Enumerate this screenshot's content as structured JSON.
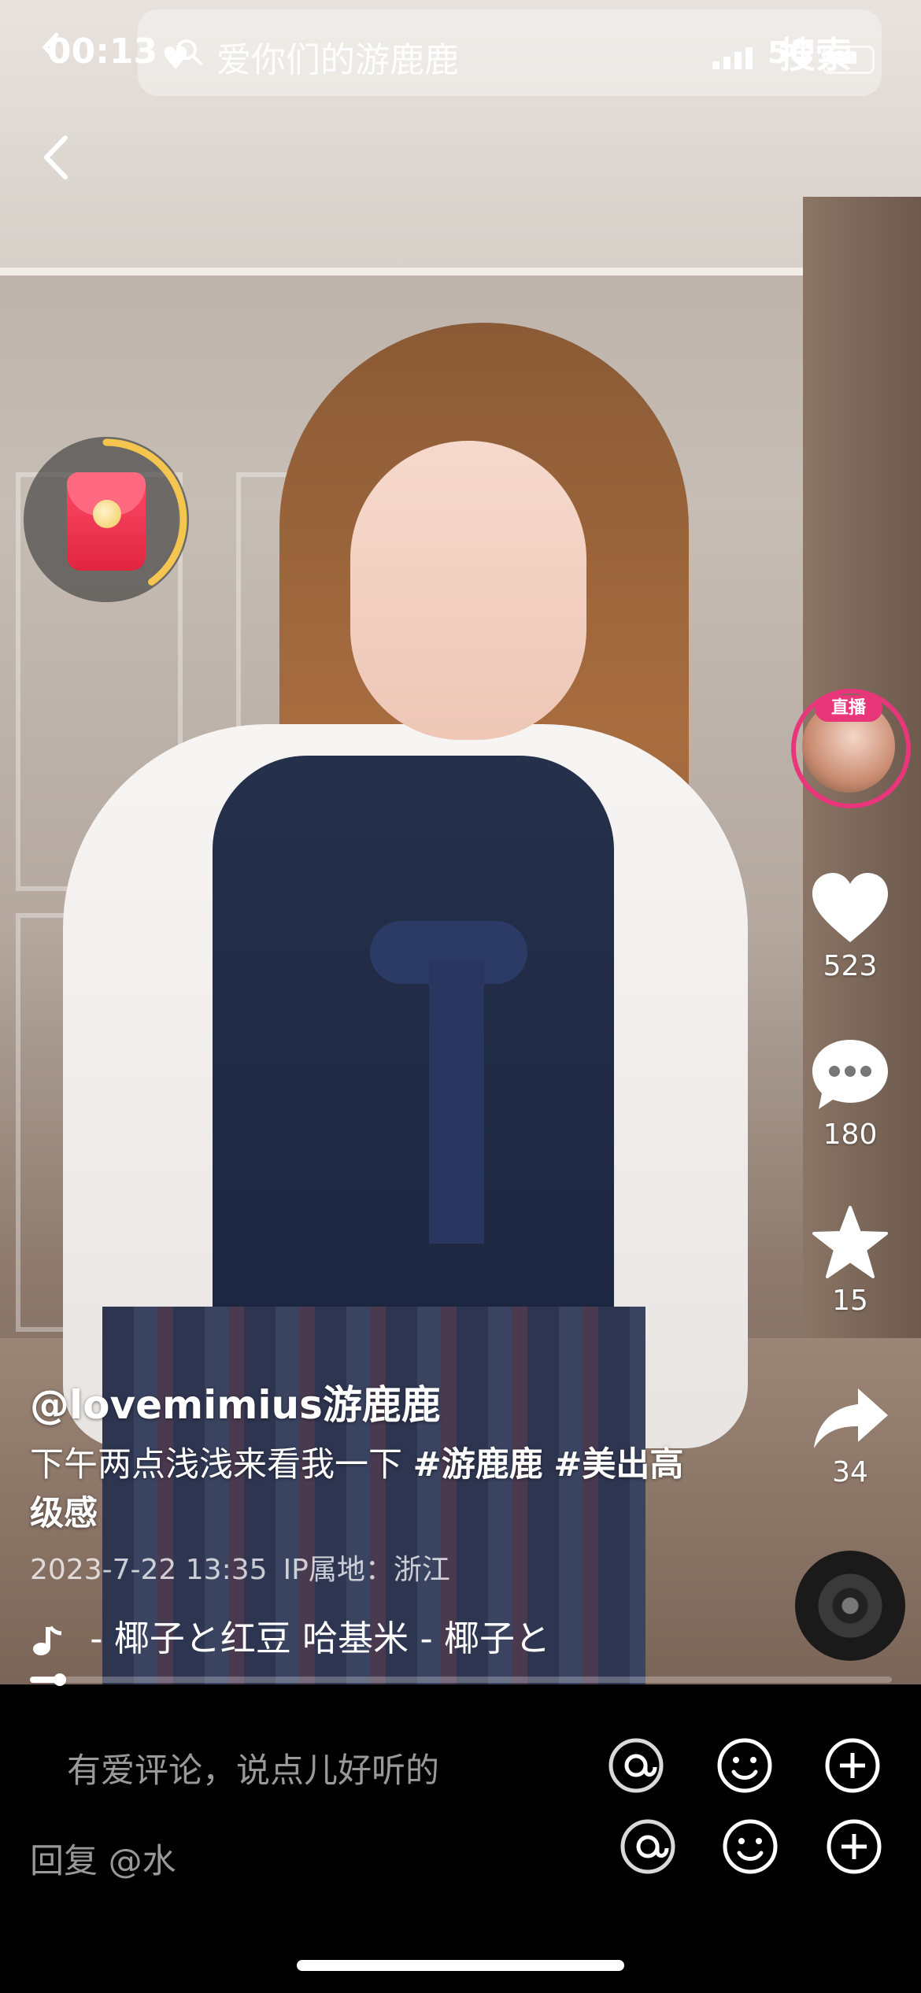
{
  "status_bar": {
    "time": "00:13",
    "network": "5G"
  },
  "search": {
    "query": "爱你们的游鹿鹿",
    "button_label": "搜索"
  },
  "red_packet": {
    "progress": 0.4
  },
  "live": {
    "badge": "直播"
  },
  "actions": {
    "like_count": "523",
    "comment_count": "180",
    "favorite_count": "15",
    "share_count": "34"
  },
  "post": {
    "author": "@lovemimius游鹿鹿",
    "caption_text": "下午两点浅浅来看我一下 ",
    "caption_tag_1": "#游鹿鹿",
    "caption_tag_2": "#美出高级感",
    "date": "2023-7-22 13:35",
    "ip": "IP属地：浙江",
    "music": " - 椰子と红豆    哈基米 - 椰子と"
  },
  "playback": {
    "progress": 0.035
  },
  "comment": {
    "placeholder": "有爱评论，说点儿好听的",
    "reply_text": "回复 @水"
  },
  "colors": {
    "live_pink": "#e9367a",
    "packet_ring": "#f5c64f"
  }
}
